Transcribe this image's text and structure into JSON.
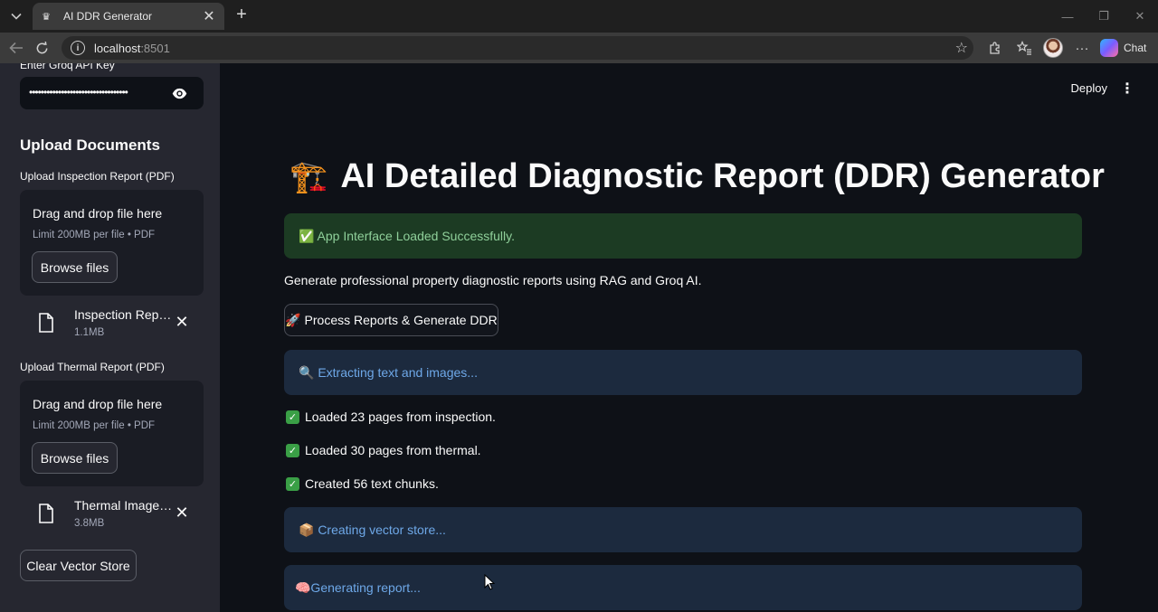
{
  "browser": {
    "tab_title": "AI DDR Generator",
    "url_host": "localhost",
    "url_port": ":8501",
    "copilot_label": "Chat"
  },
  "sidebar": {
    "api_label": "Enter Groq API Key",
    "api_value": "••••••••••••••••••••••••••••••••••",
    "section_title": "Upload Documents",
    "inspection": {
      "label": "Upload Inspection Report (PDF)",
      "drop_text": "Drag and drop file here",
      "limit_text": "Limit 200MB per file • PDF",
      "browse_label": "Browse files",
      "file_name": "Inspection Report.pdf",
      "file_size": "1.1MB"
    },
    "thermal": {
      "label": "Upload Thermal Report (PDF)",
      "drop_text": "Drag and drop file here",
      "limit_text": "Limit 200MB per file • PDF",
      "browse_label": "Browse files",
      "file_name": "Thermal Images.pdf",
      "file_size": "3.8MB"
    },
    "clear_label": "Clear Vector Store"
  },
  "main": {
    "deploy_label": "Deploy",
    "title_icon": "🏗️",
    "title": "AI Detailed Diagnostic Report (DDR) Generator",
    "success_alert": "✅ App Interface Loaded Successfully.",
    "description": "Generate professional property diagnostic reports using RAG and Groq AI.",
    "process_label": "🚀 Process Reports & Generate DDR",
    "info_extract": "🔍 Extracting text and images...",
    "log": [
      "Loaded 23 pages from inspection.",
      "Loaded 30 pages from thermal.",
      "Created 56 text chunks."
    ],
    "info_vector": "📦 Creating vector store...",
    "info_generate": "🧠Generating report..."
  },
  "colors": {
    "success_bg": "#1c3b23",
    "info_bg": "#1c2a3e",
    "sidebar_bg": "#262730",
    "main_bg": "#0e1117"
  }
}
